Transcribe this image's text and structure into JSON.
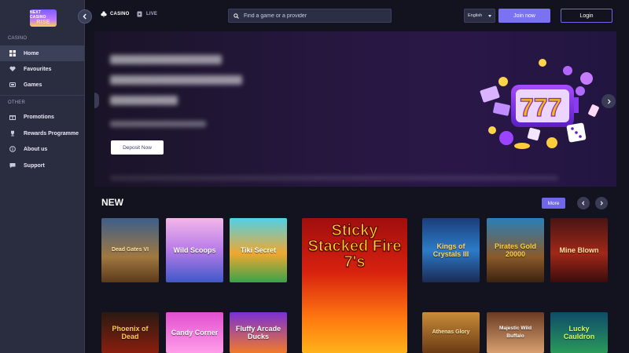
{
  "logo": {
    "line1": "NEXT CASINO",
    "line2": "RISE"
  },
  "sidebar": {
    "section_casino": "CASINO",
    "section_other": "OTHER",
    "items": [
      {
        "label": "Home",
        "icon": "grid-icon",
        "active": true
      },
      {
        "label": "Favourites",
        "icon": "heart-icon"
      },
      {
        "label": "Games",
        "icon": "games-icon"
      },
      {
        "label": "Promotions",
        "icon": "gift-icon"
      },
      {
        "label": "Rewards Programme",
        "icon": "trophy-icon"
      },
      {
        "label": "About us",
        "icon": "info-icon"
      },
      {
        "label": "Support",
        "icon": "chat-icon"
      }
    ]
  },
  "topbar": {
    "tabs": [
      {
        "label": "CASINO",
        "icon": "club-icon"
      },
      {
        "label": "LIVE",
        "icon": "live-icon"
      }
    ],
    "search_placeholder": "Find a game or a provider",
    "language": "English",
    "join_label": "Join now",
    "login_label": "Login"
  },
  "hero": {
    "cta_label": "Deposit Now"
  },
  "new_section": {
    "title": "NEW",
    "more_label": "More",
    "games": [
      {
        "title": "Dead Gates VI"
      },
      {
        "title": "Wild Scoops"
      },
      {
        "title": "Tiki Secret"
      },
      {
        "title": "Sticky Stacked Fire 7's"
      },
      {
        "title": "Kings of Crystals III"
      },
      {
        "title": "Pirates Gold 20000"
      },
      {
        "title": "Mine Blown"
      },
      {
        "title": "Phoenix of Dead"
      },
      {
        "title": "Candy Corner"
      },
      {
        "title": "Fluffy Arcade Ducks"
      },
      {
        "title": "Athenas Glory"
      },
      {
        "title": "Majestic Wild Buffalo"
      },
      {
        "title": "Lucky Cauldron"
      }
    ]
  },
  "colors": {
    "accent": "#7b72f2",
    "sidebar": "#2a2c40",
    "background": "#12131f"
  }
}
